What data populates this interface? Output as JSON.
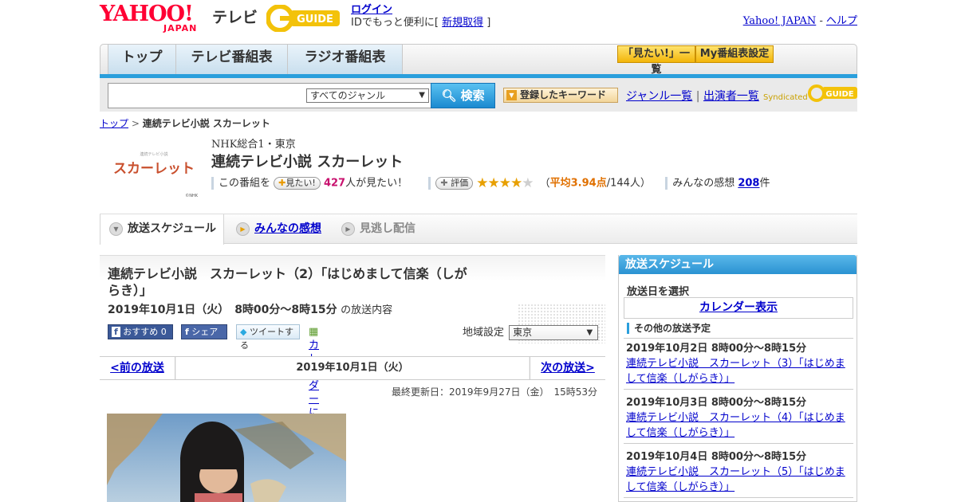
{
  "header": {
    "yahoo_logo": "YAHOO!",
    "yahoo_logo_sub": "JAPAN",
    "tv_text": "テレビ",
    "gguide_logo": "G-GUIDE",
    "login_link": "ログイン",
    "login_prefix": "IDでもっと便利に[",
    "signup_link": "新規取得",
    "login_suffix": "]",
    "yahoo_japan_link": "Yahoo! JAPAN",
    "sep": " - ",
    "help_link": "ヘルプ"
  },
  "nav": {
    "tabs": [
      "トップ",
      "テレビ番組表",
      "ラジオ番組表"
    ],
    "mitai_list_label": "「見たい!」一覧",
    "my_label": "My番組表設定"
  },
  "search": {
    "genre_value": "すべてのジャンル",
    "search_button": "検索",
    "keyword_button": "登録したキーワード",
    "genre_list_link": "ジャンル一覧",
    "divider": "|",
    "performer_link": "出演者一覧",
    "syndicated": "Syndicated",
    "syndicated_logo": "G-GUIDE"
  },
  "breadcrumb": {
    "top": "トップ",
    "sep": " > ",
    "current": "連続テレビ小説 スカーレット"
  },
  "program": {
    "thumb_title": "スカーレット",
    "thumb_small": "連続テレビ小説",
    "thumb_credit": "©NHK",
    "channel": "NHK総合1・東京",
    "title": "連続テレビ小説 スカーレット",
    "mitai_prefix": "この番組を",
    "mitai_button": "見たい!",
    "mitai_count": "427",
    "mitai_suffix": "人が見たい！",
    "rating_button": "評価",
    "rating_stars": 3.94,
    "rating_open": "（",
    "rating_avg": "平均3.94点",
    "rating_count": "/144人）",
    "kansou_prefix": "みんなの感想",
    "kansou_count": "208",
    "kansou_suffix": "件"
  },
  "subtabs": {
    "schedule": "放送スケジュール",
    "kansou": "みんなの感想",
    "minogashi": "見逃し配信"
  },
  "episode": {
    "title": "連続テレビ小説　スカーレット（2）「はじめまして信楽（しがらき）」",
    "time_bold": "2019年10月1日（火）　8時00分～8時15分",
    "time_suffix": "の放送内容",
    "fb_recommend": "おすすめ 0",
    "fb_share": "シェア",
    "tweet": "ツイートする",
    "calendar_register": "カレンダーに登録",
    "region_label": "地域設定",
    "region_value": "東京"
  },
  "pager": {
    "prev": "<前の放送",
    "date": "2019年10月1日（火）",
    "next": "次の放送>"
  },
  "updated": "最終更新日：2019年9月27日（金）　15時53分",
  "sidebar": {
    "header": "放送スケジュール",
    "select_label": "放送日を選択",
    "calendar_button": "カレンダー表示",
    "other_label": "その他の放送予定",
    "schedules": [
      {
        "time": "2019年10月2日 8時00分～8時15分",
        "title": "連続テレビ小説　スカーレット（3）「はじめまして信楽（しがらき）」"
      },
      {
        "time": "2019年10月3日 8時00分～8時15分",
        "title": "連続テレビ小説　スカーレット（4）「はじめまして信楽（しがらき）」"
      },
      {
        "time": "2019年10月4日 8時00分～8時15分",
        "title": "連続テレビ小説　スカーレット（5）「はじめまして信楽（しがらき）」"
      }
    ]
  },
  "colors": {
    "accent_blue": "#2a9fdc",
    "yahoo_red": "#ff0033",
    "star_gold": "#e8a000",
    "mitai_pink": "#c8116e"
  }
}
